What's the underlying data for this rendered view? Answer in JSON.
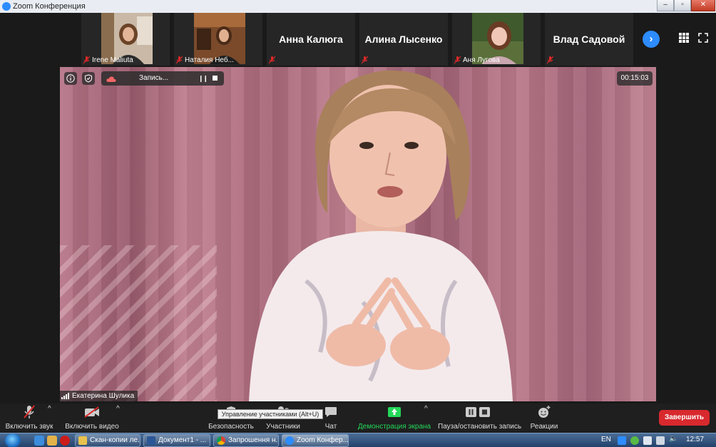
{
  "window": {
    "title": "Zoom Конференция",
    "minimize": "–",
    "maximize": "▫",
    "close": "✕"
  },
  "thumbnails": [
    {
      "name": "Irene Maliuta",
      "video": true
    },
    {
      "name": "Наталия Неб...",
      "video": true
    },
    {
      "name": "Анна Калюга",
      "video": false
    },
    {
      "name": "Алина Лысенко",
      "video": false
    },
    {
      "name": "Аня Лугова",
      "video": true
    },
    {
      "name": "Влад Садовой",
      "video": false
    }
  ],
  "main_video": {
    "recording_label": "Запись...",
    "timer": "00:15:03",
    "speaker_name": "Екатерина Шулика"
  },
  "toolbar": {
    "audio": "Включить звук",
    "video": "Включить видео",
    "security": "Безопасность",
    "participants": "Участники",
    "chat": "Чат",
    "share": "Демонстрация экрана",
    "record": "Пауза/остановить запись",
    "reactions": "Реакции",
    "end": "Завершить",
    "tooltip": "Управление участниками (Alt+U)"
  },
  "taskbar": {
    "tasks": [
      {
        "label": "Скан-копии ле..."
      },
      {
        "label": "Документ1 - ..."
      },
      {
        "label": "Запрошення н..."
      },
      {
        "label": "Zoom Конфер..."
      }
    ],
    "language": "EN",
    "clock": "12:57"
  },
  "colors": {
    "accent": "#2d8cff",
    "share_green": "#23d959",
    "end_red": "#d8292e",
    "muted_red": "#e02828"
  }
}
